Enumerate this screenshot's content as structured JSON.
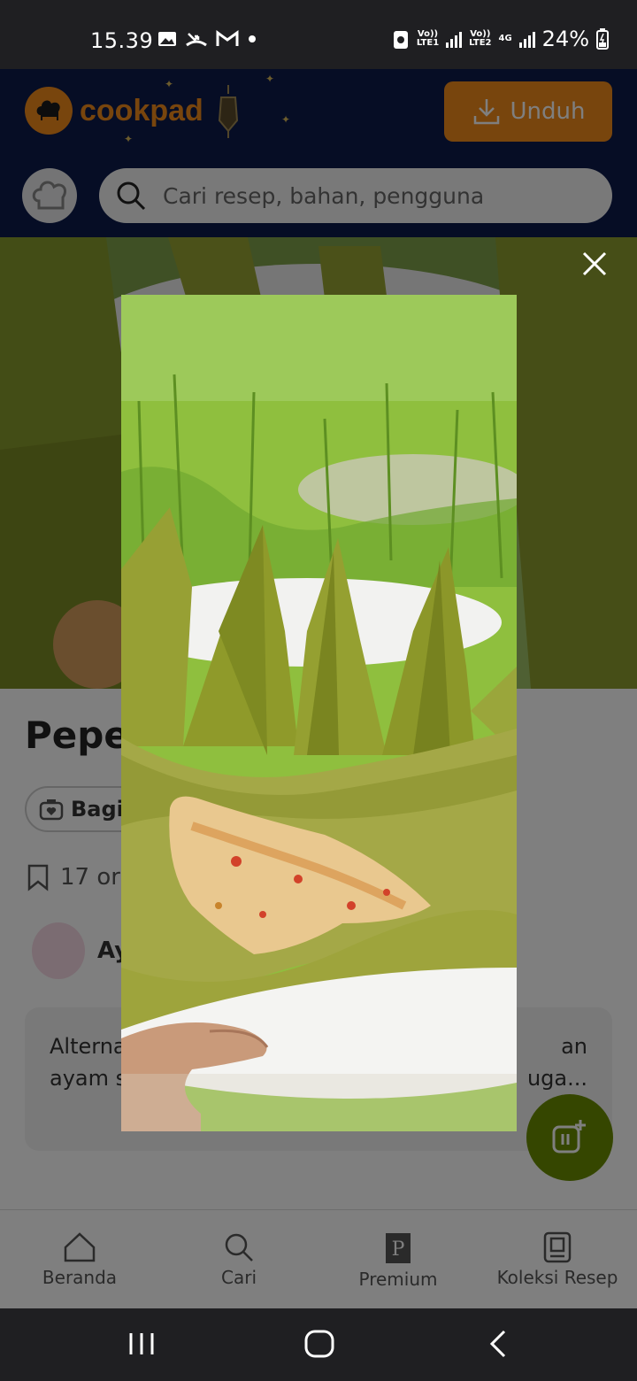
{
  "status_bar": {
    "time": "15.39",
    "battery": "24%",
    "sim1_label": "Vo)) LTE1",
    "sim2_label": "Vo)) LTE2",
    "network": "4G"
  },
  "header": {
    "brand": "cookpad",
    "download_label": "Unduh",
    "brand_color": "#f08a1b"
  },
  "search": {
    "placeholder": "Cari resep, bahan, pengguna"
  },
  "recipe": {
    "title_visible": "Pepes",
    "share_label_visible": "Bagik",
    "saved_visible": "17 or",
    "author_visible": "Ay",
    "description_line1_left": "Alterna",
    "description_line1_right": "an",
    "description_line2_left": "ayam s",
    "description_line2_right": "uga..."
  },
  "bottom_nav": {
    "items": [
      {
        "label": "Beranda",
        "icon": "home-icon"
      },
      {
        "label": "Cari",
        "icon": "search-icon"
      },
      {
        "label": "Premium",
        "icon": "premium-icon"
      },
      {
        "label": "Koleksi Resep",
        "icon": "collection-icon"
      }
    ]
  },
  "overlay": {
    "close_icon": "close-icon",
    "image_subject": "pepes-in-banana-leaf-photo"
  },
  "colors": {
    "header_bg": "#0d1a4a",
    "fab": "#6a8d00",
    "leaf": "#8f9a2a"
  }
}
